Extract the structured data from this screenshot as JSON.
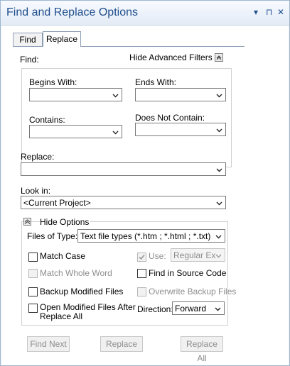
{
  "window": {
    "title": "Find and Replace Options",
    "pin_glyph": "▾ ⊓ ✕"
  },
  "tabs": [
    {
      "label": "Find"
    },
    {
      "label": "Replace"
    }
  ],
  "find": {
    "label": "Find:",
    "hide_advanced_label": "Hide Advanced Filters",
    "begins_with_label": "Begins With:",
    "ends_with_label": "Ends With:",
    "contains_label": "Contains:",
    "does_not_contain_label": "Does Not Contain:",
    "begins_with_value": "",
    "ends_with_value": "",
    "contains_value": "",
    "does_not_contain_value": ""
  },
  "replace": {
    "label": "Replace:",
    "value": ""
  },
  "look_in": {
    "label": "Look in:",
    "value": "<Current Project>"
  },
  "options": {
    "hide_options_label": "Hide Options",
    "files_of_type_label": "Files of Type:",
    "files_of_type_value": "Text file types (*.htm ; *.html ; *.txt)",
    "match_case": "Match Case",
    "use_label": "Use:",
    "use_value": "Regular Ex",
    "match_whole_word": "Match Whole Word",
    "find_in_source": "Find in Source Code",
    "backup_modified": "Backup Modified Files",
    "overwrite_backup": "Overwrite Backup Files",
    "open_modified_line1": "Open Modified Files After",
    "open_modified_line2": "Replace All",
    "direction_label": "Direction:",
    "direction_value": "Forward"
  },
  "buttons": {
    "find_next": "Find Next",
    "replace": "Replace",
    "replace_all": "Replace All"
  }
}
